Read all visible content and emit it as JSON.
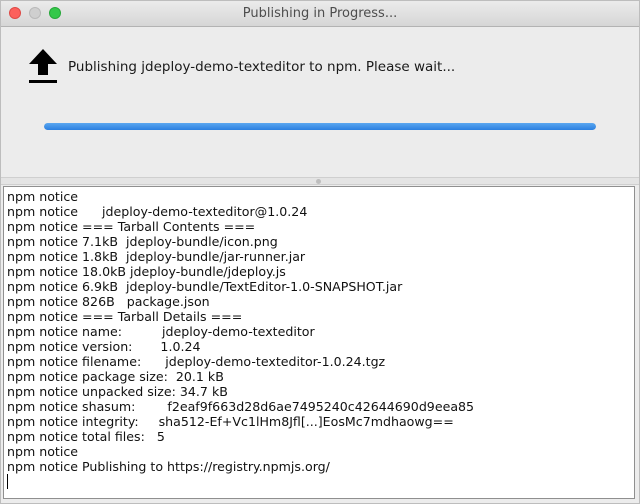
{
  "window": {
    "title": "Publishing in Progress..."
  },
  "header": {
    "icon": "upload-arrow-icon",
    "message": "Publishing jdeploy-demo-texteditor to npm.  Please wait...",
    "progress": 1.0
  },
  "log": {
    "lines": [
      "npm notice",
      "npm notice      jdeploy-demo-texteditor@1.0.24",
      "npm notice === Tarball Contents ===",
      "npm notice 7.1kB  jdeploy-bundle/icon.png",
      "npm notice 1.8kB  jdeploy-bundle/jar-runner.jar",
      "npm notice 18.0kB jdeploy-bundle/jdeploy.js",
      "npm notice 6.9kB  jdeploy-bundle/TextEditor-1.0-SNAPSHOT.jar",
      "npm notice 826B   package.json",
      "npm notice === Tarball Details ===",
      "npm notice name:          jdeploy-demo-texteditor",
      "npm notice version:       1.0.24",
      "npm notice filename:      jdeploy-demo-texteditor-1.0.24.tgz",
      "npm notice package size:  20.1 kB",
      "npm notice unpacked size: 34.7 kB",
      "npm notice shasum:        f2eaf9f663d28d6ae7495240c42644690d9eea85",
      "npm notice integrity:     sha512-Ef+Vc1lHm8Jfl[...]EosMc7mdhaowg==",
      "npm notice total files:   5",
      "npm notice",
      "npm notice Publishing to https://registry.npmjs.org/"
    ]
  }
}
